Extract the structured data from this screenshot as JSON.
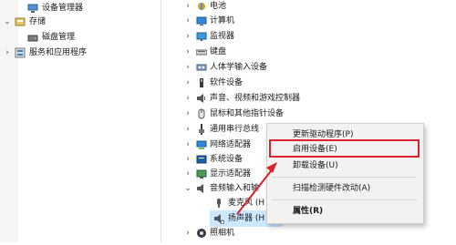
{
  "left_tree": {
    "items": [
      {
        "label": "设备管理器",
        "icon": "device-manager-icon"
      },
      {
        "label": "存储",
        "icon": "storage-icon"
      },
      {
        "label": "磁盘管理",
        "icon": "disk-management-icon"
      },
      {
        "label": "服务和应用程序",
        "icon": "services-apps-icon"
      }
    ]
  },
  "right_tree": {
    "items": [
      {
        "label": "电池",
        "icon": "battery-icon"
      },
      {
        "label": "计算机",
        "icon": "computer-icon"
      },
      {
        "label": "监视器",
        "icon": "monitor-icon"
      },
      {
        "label": "键盘",
        "icon": "keyboard-icon"
      },
      {
        "label": "人体学输入设备",
        "icon": "hid-icon"
      },
      {
        "label": "软件设备",
        "icon": "software-device-icon"
      },
      {
        "label": "声音、视频和游戏控制器",
        "icon": "sound-icon"
      },
      {
        "label": "鼠标和其他指针设备",
        "icon": "mouse-icon"
      },
      {
        "label": "通用串行总线",
        "icon": "usb-icon"
      },
      {
        "label": "网络适配器",
        "icon": "network-adapter-icon"
      },
      {
        "label": "系统设备",
        "icon": "system-device-icon"
      },
      {
        "label": "显示适配器",
        "icon": "display-adapter-icon"
      },
      {
        "label": "音频输入和输",
        "icon": "audio-io-icon"
      },
      {
        "label": "麦克风 (H",
        "icon": "microphone-icon"
      },
      {
        "label": "扬声器 (H",
        "icon": "speaker-icon"
      },
      {
        "label": "照相机",
        "icon": "camera-icon"
      }
    ]
  },
  "context_menu": {
    "items": [
      {
        "label": "更新驱动程序(P)"
      },
      {
        "label": "启用设备(E)"
      },
      {
        "label": "卸载设备(U)"
      },
      {
        "label": "扫描检测硬件改动(A)"
      },
      {
        "label": "属性(R)"
      }
    ]
  },
  "colors": {
    "highlight_box": "#d9232f",
    "arrow": "#d9232f",
    "selected_row": "#cce8ff"
  }
}
